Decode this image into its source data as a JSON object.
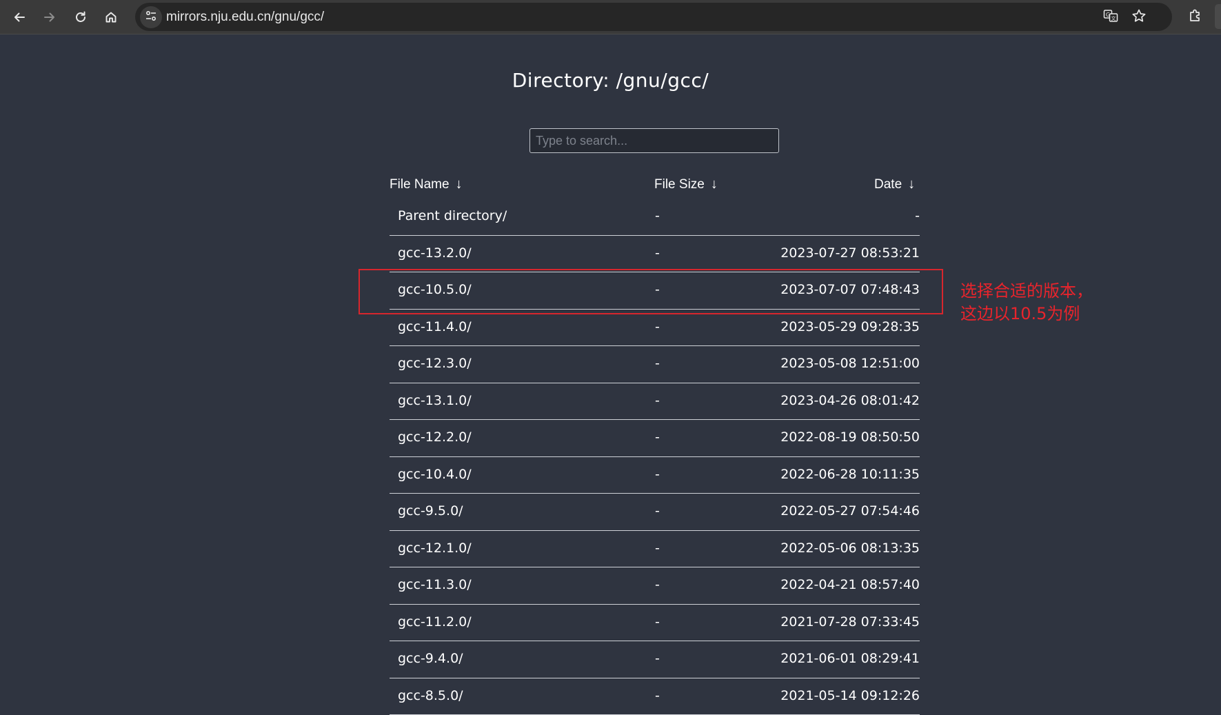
{
  "browser": {
    "url": "mirrors.nju.edu.cn/gnu/gcc/"
  },
  "page": {
    "title": "Directory: /gnu/gcc/",
    "search_placeholder": "Type to search..."
  },
  "table": {
    "headers": {
      "name": "File Name",
      "size": "File Size",
      "date": "Date",
      "sort_arrow": "↓"
    },
    "rows": [
      {
        "name": "Parent directory/",
        "size": "-",
        "date": "-"
      },
      {
        "name": "gcc-13.2.0/",
        "size": "-",
        "date": "2023-07-27 08:53:21"
      },
      {
        "name": "gcc-10.5.0/",
        "size": "-",
        "date": "2023-07-07 07:48:43"
      },
      {
        "name": "gcc-11.4.0/",
        "size": "-",
        "date": "2023-05-29 09:28:35"
      },
      {
        "name": "gcc-12.3.0/",
        "size": "-",
        "date": "2023-05-08 12:51:00"
      },
      {
        "name": "gcc-13.1.0/",
        "size": "-",
        "date": "2023-04-26 08:01:42"
      },
      {
        "name": "gcc-12.2.0/",
        "size": "-",
        "date": "2022-08-19 08:50:50"
      },
      {
        "name": "gcc-10.4.0/",
        "size": "-",
        "date": "2022-06-28 10:11:35"
      },
      {
        "name": "gcc-9.5.0/",
        "size": "-",
        "date": "2022-05-27 07:54:46"
      },
      {
        "name": "gcc-12.1.0/",
        "size": "-",
        "date": "2022-05-06 08:13:35"
      },
      {
        "name": "gcc-11.3.0/",
        "size": "-",
        "date": "2022-04-21 08:57:40"
      },
      {
        "name": "gcc-11.2.0/",
        "size": "-",
        "date": "2021-07-28 07:33:45"
      },
      {
        "name": "gcc-9.4.0/",
        "size": "-",
        "date": "2021-06-01 08:29:41"
      },
      {
        "name": "gcc-8.5.0/",
        "size": "-",
        "date": "2021-05-14 09:12:26"
      }
    ]
  },
  "annotation": {
    "line1": "选择合适的版本，",
    "line2": "这边以10.5为例",
    "color": "#e8242c"
  },
  "icons": {
    "back": "arrow-left-icon",
    "forward": "arrow-right-icon",
    "reload": "reload-icon",
    "home": "home-icon",
    "site_info": "tune-icon",
    "translate": "translate-icon",
    "bookmark": "star-icon",
    "extensions": "puzzle-icon"
  }
}
